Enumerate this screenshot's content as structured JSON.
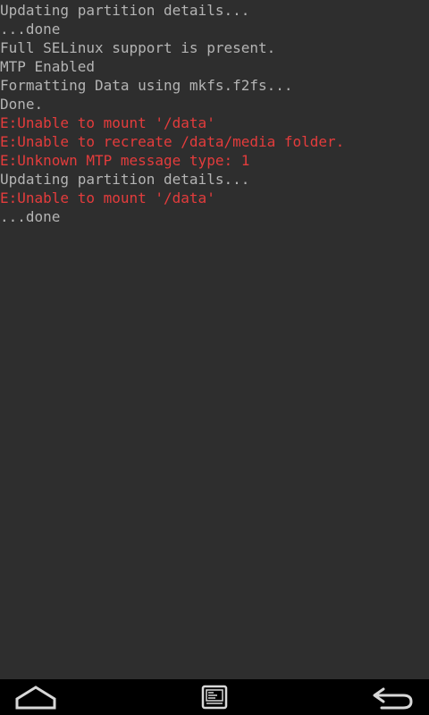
{
  "console": {
    "lines": [
      {
        "text": "Updating partition details...",
        "type": "info"
      },
      {
        "text": "...done",
        "type": "info"
      },
      {
        "text": "Full SELinux support is present.",
        "type": "info"
      },
      {
        "text": "MTP Enabled",
        "type": "info"
      },
      {
        "text": "Formatting Data using mkfs.f2fs...",
        "type": "info"
      },
      {
        "text": "Done.",
        "type": "info"
      },
      {
        "text": "E:Unable to mount '/data'",
        "type": "error"
      },
      {
        "text": "E:Unable to recreate /data/media folder.",
        "type": "error"
      },
      {
        "text": "E:Unknown MTP message type: 1",
        "type": "error"
      },
      {
        "text": "Updating partition details...",
        "type": "info"
      },
      {
        "text": "E:Unable to mount '/data'",
        "type": "error"
      },
      {
        "text": "...done",
        "type": "info"
      }
    ]
  },
  "navbar": {
    "icons": [
      "home-icon",
      "console-icon",
      "back-icon"
    ]
  },
  "colors": {
    "background": "#2e2e2e",
    "text": "#b4b4b4",
    "error": "#e43c3c",
    "navbar": "#000000"
  }
}
